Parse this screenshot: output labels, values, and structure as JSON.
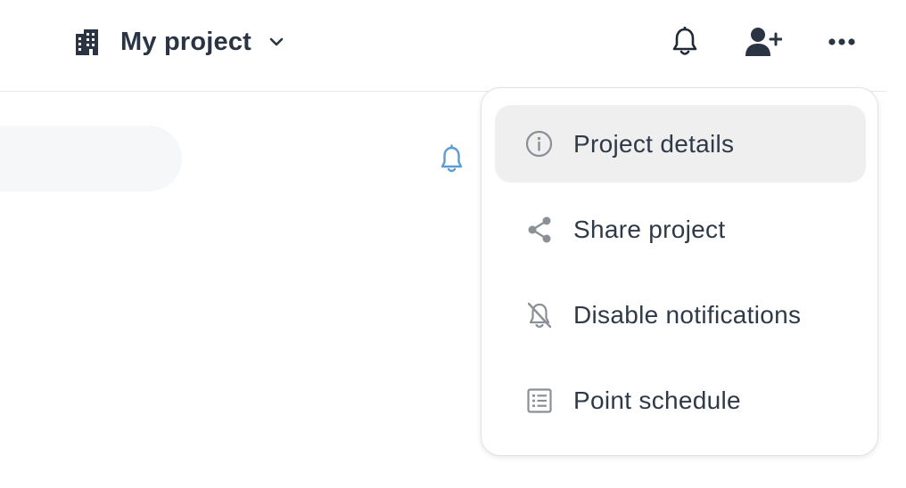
{
  "header": {
    "project_name": "My project",
    "icons": {
      "project": "building-icon",
      "project_chevron": "chevron-down-icon",
      "notifications": "bell-icon",
      "invite": "add-user-icon",
      "more": "more-horizontal-icon"
    }
  },
  "content": {
    "bell_icon": "bell-icon",
    "accent_color": "#5b9bd5"
  },
  "dropdown_menu": {
    "items": [
      {
        "label": "Project details",
        "icon": "info-icon",
        "highlighted": true
      },
      {
        "label": "Share project",
        "icon": "share-icon",
        "highlighted": false
      },
      {
        "label": "Disable notifications",
        "icon": "bell-off-icon",
        "highlighted": false
      },
      {
        "label": "Point schedule",
        "icon": "list-icon",
        "highlighted": false
      }
    ]
  }
}
